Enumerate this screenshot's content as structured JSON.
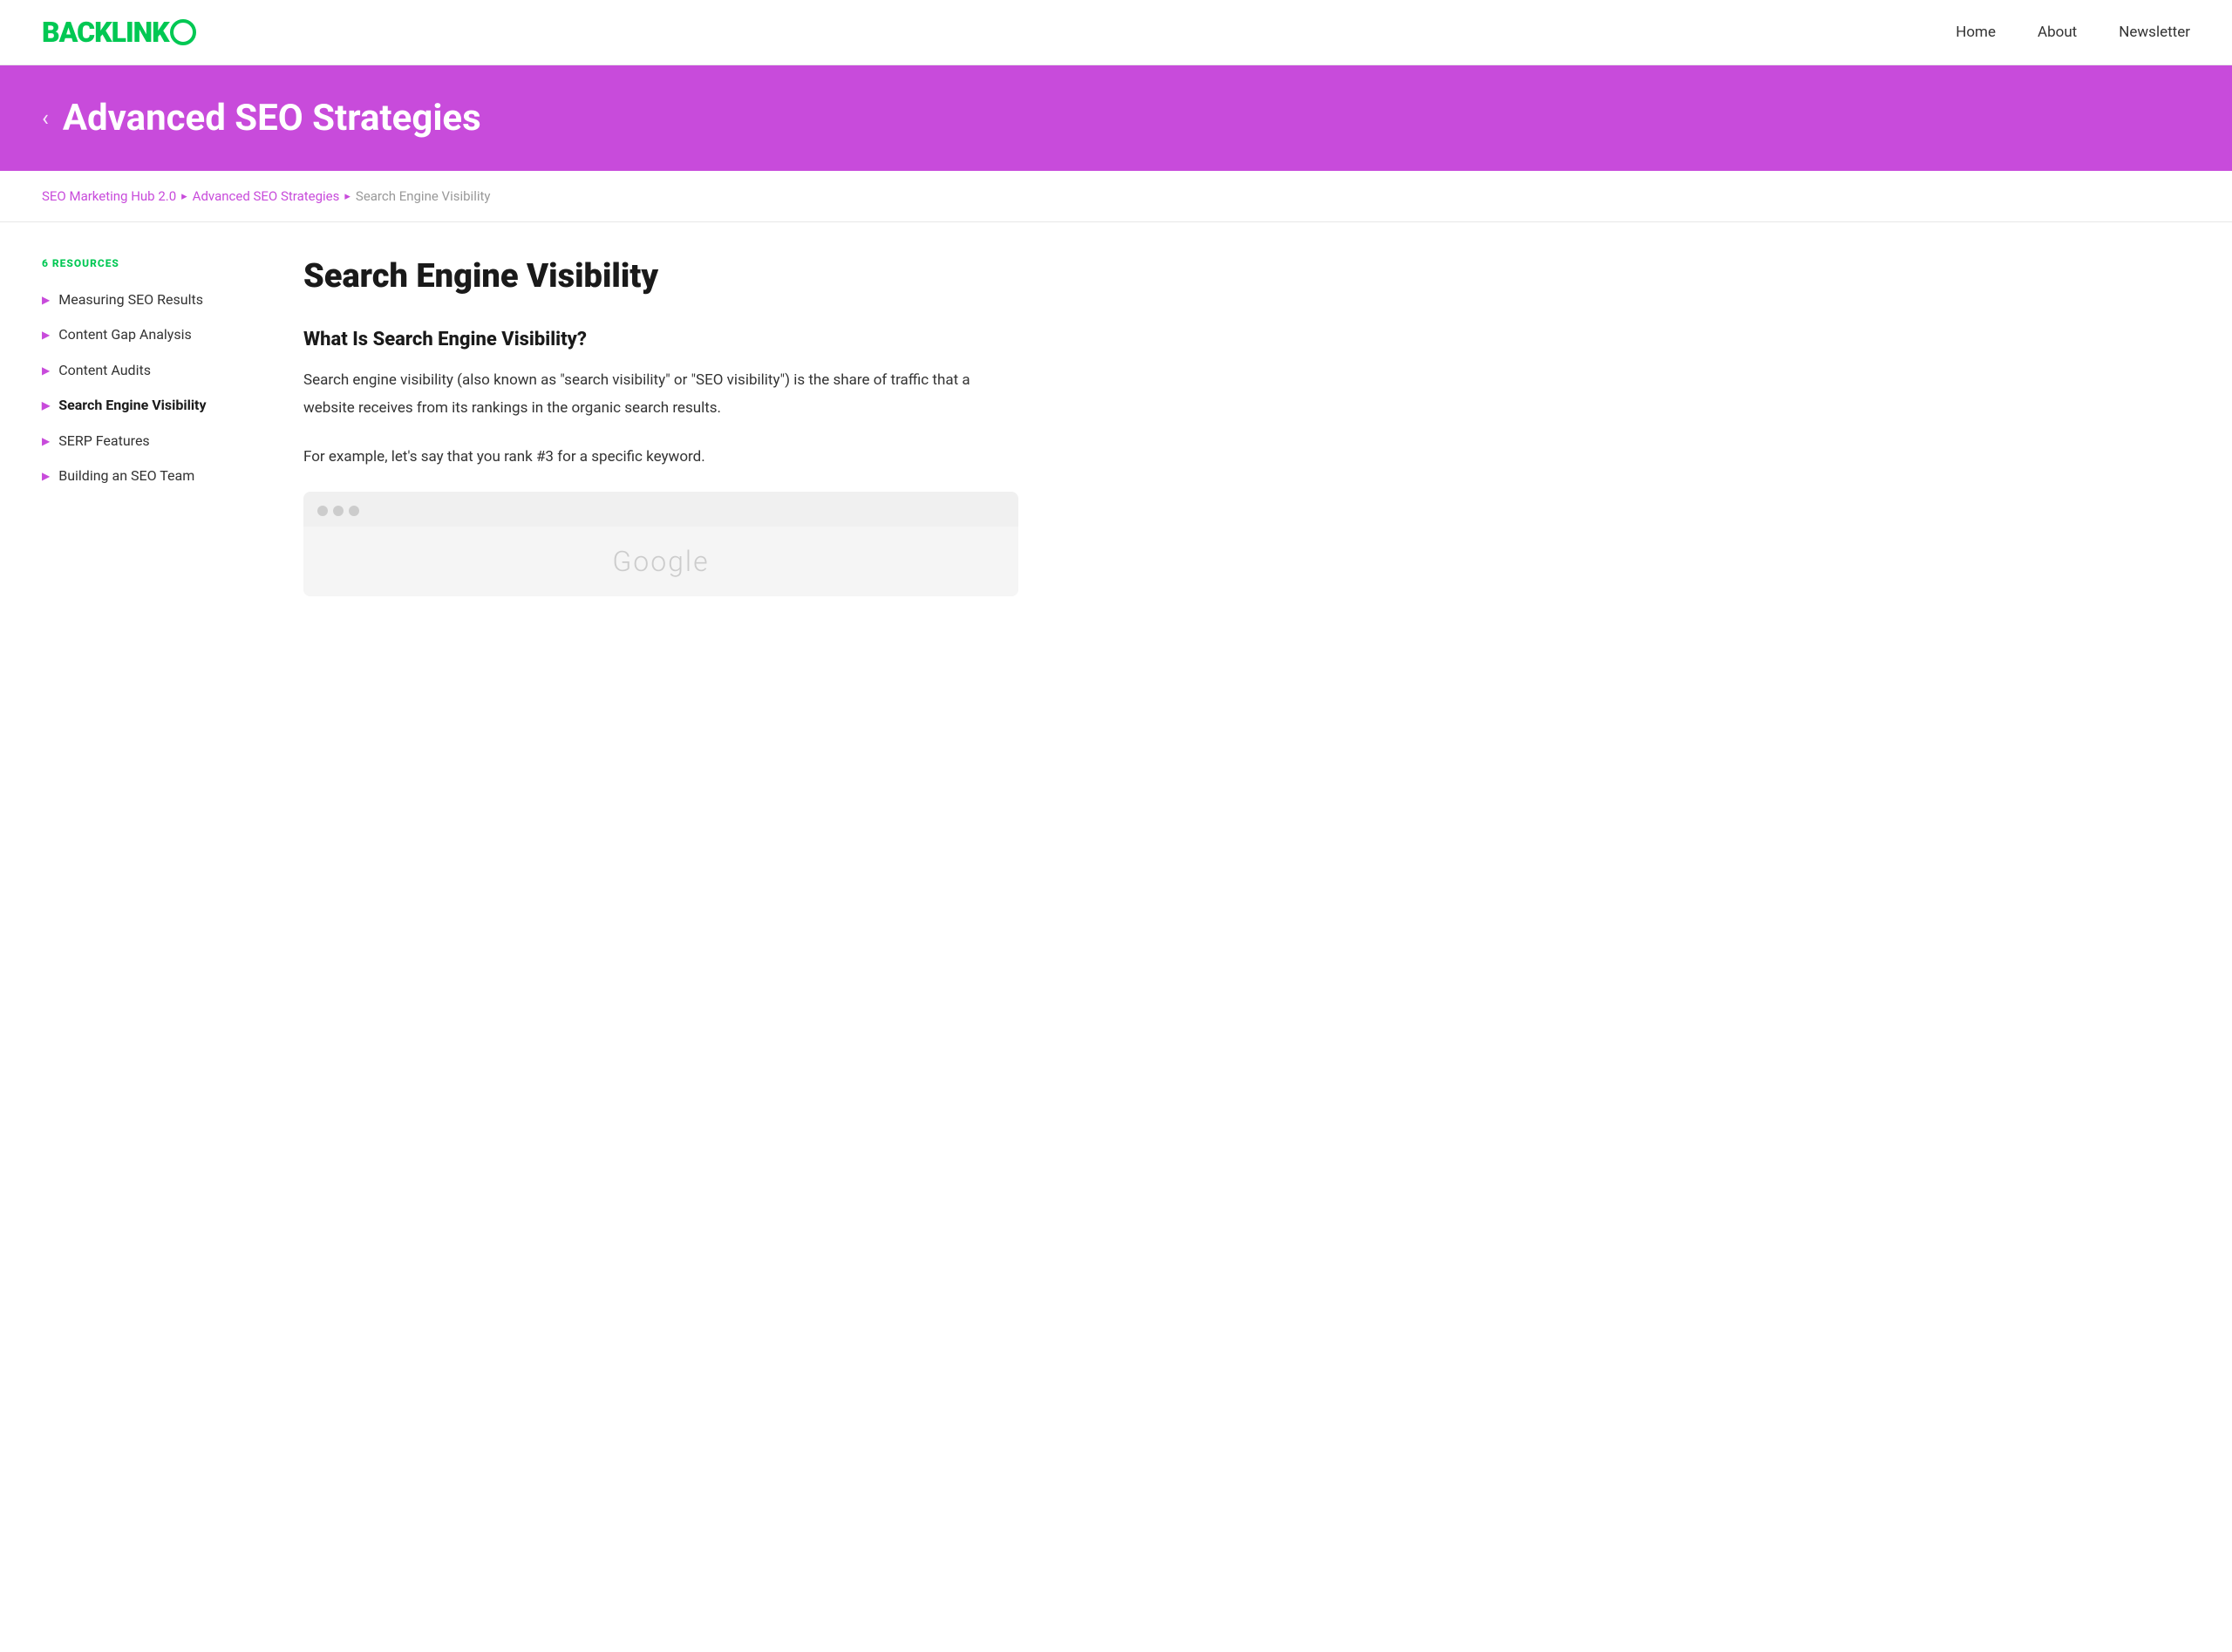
{
  "header": {
    "logo_text": "BACKLINK",
    "logo_o": "O",
    "nav": {
      "items": [
        {
          "label": "Home",
          "id": "home"
        },
        {
          "label": "About",
          "id": "about"
        },
        {
          "label": "Newsletter",
          "id": "newsletter"
        }
      ]
    }
  },
  "hero": {
    "back_arrow": "‹",
    "title": "Advanced SEO Strategies"
  },
  "breadcrumb": {
    "items": [
      {
        "label": "SEO Marketing Hub 2.0",
        "link": true
      },
      {
        "label": "Advanced SEO Strategies",
        "link": true
      },
      {
        "label": "Search Engine Visibility",
        "link": false
      }
    ],
    "separator": "▸"
  },
  "sidebar": {
    "resources_label": "6 RESOURCES",
    "items": [
      {
        "label": "Measuring SEO Results",
        "active": false
      },
      {
        "label": "Content Gap Analysis",
        "active": false
      },
      {
        "label": "Content Audits",
        "active": false
      },
      {
        "label": "Search Engine Visibility",
        "active": true
      },
      {
        "label": "SERP Features",
        "active": false
      },
      {
        "label": "Building an SEO Team",
        "active": false
      }
    ]
  },
  "article": {
    "title": "Search Engine Visibility",
    "section_title": "What Is Search Engine Visibility?",
    "paragraph_1": "Search engine visibility (also known as \"search visibility\" or \"SEO visibility\") is the share of traffic that a website receives from its rankings in the organic search results.",
    "paragraph_2": "For example, let's say that you rank #3 for a specific keyword.",
    "browser_mockup_text": "Google"
  }
}
